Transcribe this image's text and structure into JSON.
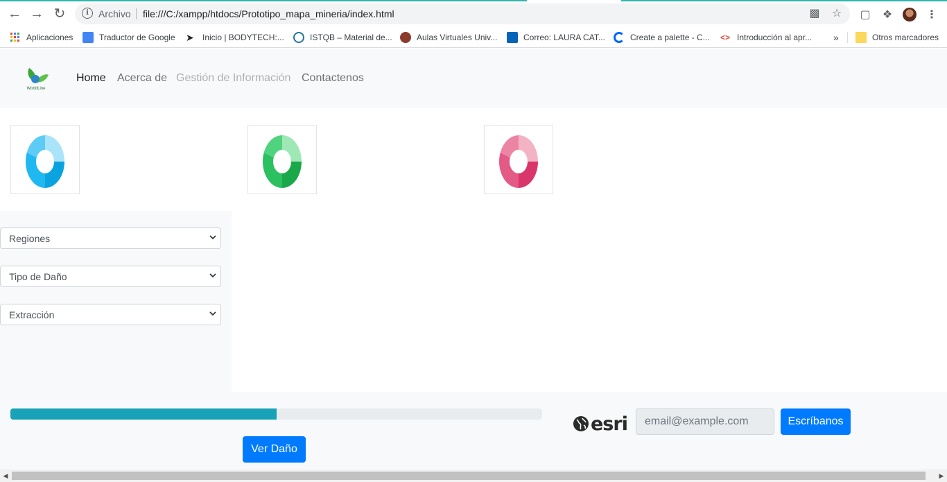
{
  "browser": {
    "scheme_label": "Archivo",
    "url": "file:///C:/xampp/htdocs/Prototipo_mapa_mineria/index.html",
    "bookmarks": [
      {
        "label": "Aplicaciones",
        "icon": "apps-grid-icon"
      },
      {
        "label": "Traductor de Google",
        "icon": "google-translate-icon"
      },
      {
        "label": "Inicio | BODYTECH:...",
        "icon": "bodytech-icon"
      },
      {
        "label": "ISTQB – Material de...",
        "icon": "wordpress-icon"
      },
      {
        "label": "Aulas Virtuales Univ...",
        "icon": "university-icon"
      },
      {
        "label": "Correo: LAURA CAT...",
        "icon": "outlook-icon"
      },
      {
        "label": "Create a palette - C...",
        "icon": "coolors-icon"
      },
      {
        "label": "Introducción al apr...",
        "icon": "code-icon"
      }
    ],
    "overflow_label": "»",
    "other_bookmarks": "Otros marcadores"
  },
  "navbar": {
    "logo_text": "WorldLine",
    "links": [
      {
        "label": "Home",
        "state": "active"
      },
      {
        "label": "Acerca de",
        "state": "normal"
      },
      {
        "label": "Gestión de Información",
        "state": "disabled"
      },
      {
        "label": "Contactenos",
        "state": "normal"
      }
    ]
  },
  "thumbnails": [
    {
      "name": "blue-donut-chart-image",
      "colors": [
        "#0aa3e0",
        "#20b8f0",
        "#5ccbf5",
        "#a9e4fa"
      ]
    },
    {
      "name": "green-donut-chart-image",
      "colors": [
        "#1aa84a",
        "#2bc060",
        "#4fd37e",
        "#9ee8b5"
      ]
    },
    {
      "name": "pink-donut-chart-image",
      "colors": [
        "#d9366b",
        "#e45a86",
        "#ec84a3",
        "#f4b2c5"
      ]
    }
  ],
  "filters": {
    "regions": "Regiones",
    "damage_type": "Tipo de Daño",
    "extraction": "Extracción"
  },
  "footer": {
    "progress_fraction": 0.5,
    "ver_dano": "Ver Daño",
    "esri_text": "esri",
    "email_placeholder": "email@example.com",
    "submit": "Escríbanos"
  },
  "colors": {
    "primary": "#007bff",
    "progress": "#17a2b8",
    "light": "#f8f9fa"
  }
}
